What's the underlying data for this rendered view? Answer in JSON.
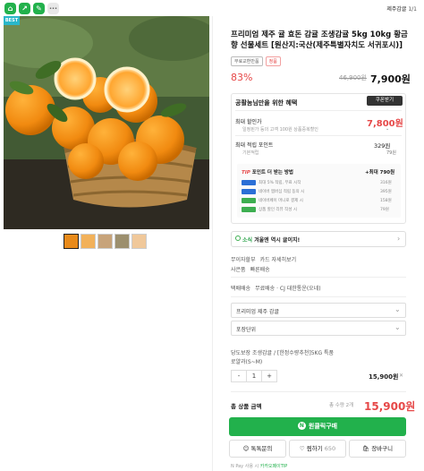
{
  "topbar": {
    "store_name": "제주감귤",
    "page_indicator": "1/1"
  },
  "badge": "BEST",
  "product": {
    "title": "프리미엄 제주 귤 효돈 감귤 조생감귤 5kg 10kg 황금향 선물세트 [원산지:국산(제주특별자치도 서귀포시)]",
    "tags": [
      "무료교환반품",
      "정품"
    ],
    "discount": "83%",
    "original_price": "46,900원",
    "sale_price": "7,900원"
  },
  "benefit": {
    "title": "공활눔님만을 위한 혜택",
    "coupon_button": "쿠폰받기",
    "max_discount_label": "최대 할인가",
    "max_discount_sub": "일정된가 등의 고객 100원 상품중복할인",
    "max_discount_value": "7,800원",
    "max_points_label": "최대 적립 포인트",
    "max_points_sub": "기본적립",
    "max_points_value": "329원",
    "base_points": "79원",
    "tip_title_prefix": "TIP",
    "tip_title": "포인트 더 받는 방법",
    "tip_total": "+최대 790원",
    "tips": [
      {
        "text": "최대 5% 적립, 무료 시작",
        "value": "316원"
      },
      {
        "text": "네이버 멤버십 적립 동의 시",
        "value": "395원"
      },
      {
        "text": "네이버페이 머니로 결제 시",
        "value": "158원"
      },
      {
        "text": "상품 할인 리뷰 작성 시",
        "value": "79원"
      }
    ]
  },
  "ad": {
    "brand": "소식",
    "text": "겨울엔 역시 귤이지!"
  },
  "shipping": {
    "free_label": "무이자할부",
    "free_value": "카드 자세히보기",
    "service_label": "사은품",
    "service_value": "빠른배송",
    "delivery_label": "택배배송",
    "delivery_value": "무료배송 · CJ 대한통운(오네)"
  },
  "options": {
    "select1": "프리미엄 제주 감귤",
    "select2": "포장단위",
    "selected_line1": "당도보장 조생감귤 / [한정수량추천]5KG 특품",
    "selected_line2": "로얄과(S~M)",
    "quantity": "1",
    "minus": "-",
    "plus": "+",
    "line_price": "15,900원"
  },
  "total": {
    "label": "총 상품 금액",
    "qty": "총 수량 2개",
    "price": "15,900원"
  },
  "buttons": {
    "buy": "원클릭구매",
    "talk": "톡톡문의",
    "like": "찜하기",
    "like_count": "650",
    "cart": "장바구니"
  },
  "footnote": {
    "prefix": "N Pay 사용 시",
    "highlight": "카카오페이TIP"
  }
}
